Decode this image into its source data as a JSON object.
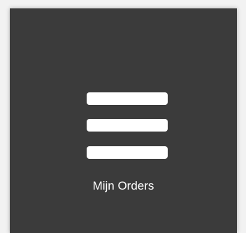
{
  "tile": {
    "label": "Mijn Orders",
    "icon": "hamburger-menu-icon",
    "background": "#3b3b3b",
    "foreground": "#ffffff"
  }
}
